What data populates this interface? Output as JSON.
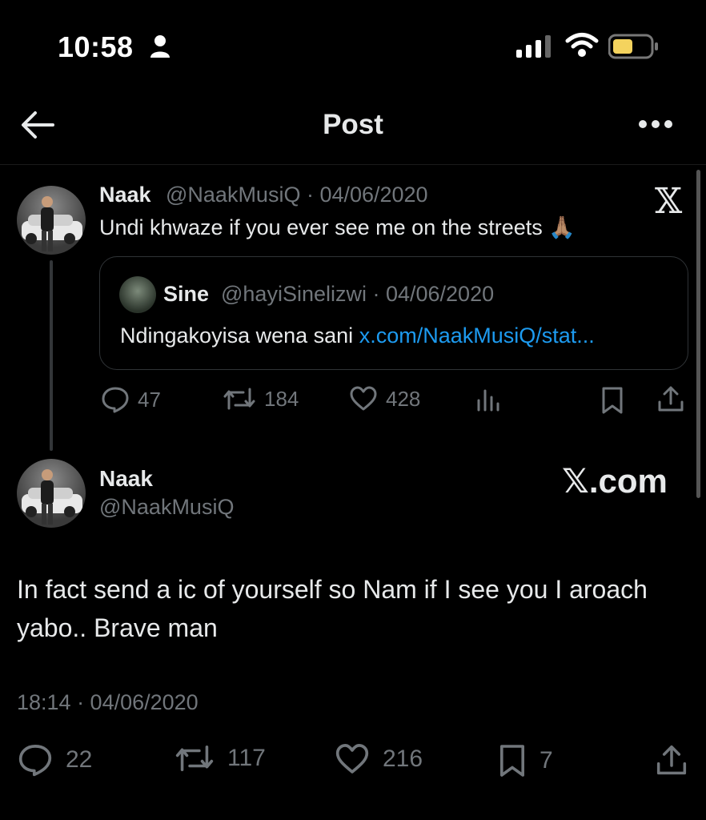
{
  "status_bar": {
    "time": "10:58",
    "icons": [
      "person-icon",
      "cellular-signal-icon",
      "wifi-icon",
      "battery-icon"
    ],
    "battery_color": "#f4d35e"
  },
  "header": {
    "title": "Post",
    "back_icon": "arrow-left-icon",
    "more_icon": "more-dots-icon"
  },
  "quoted_parent": {
    "name": "Naak",
    "handle_date": "@NaakMusiQ · 04/06/2020",
    "text": "Undi khwaze if you ever see me on the streets 🙏🏽",
    "brand": "𝕏",
    "quote": {
      "name": "Sine",
      "handle_date": "@hayiSinelizwi · 04/06/2020",
      "text": "Ndingakoyisa wena sani ",
      "link": "x.com/NaakMusiQ/stat..."
    },
    "actions": {
      "replies": "47",
      "reposts": "184",
      "likes": "428"
    }
  },
  "main_post": {
    "name": "Naak",
    "handle": "@NaakMusiQ",
    "brand": "𝕏.com",
    "text": "In fact send a ic of yourself so Nam if I see you I aroach yabo.. Brave man",
    "timestamp": "18:14 · 04/06/2020",
    "actions": {
      "replies": "22",
      "reposts": "117",
      "likes": "216",
      "bookmarks": "7"
    }
  },
  "colors": {
    "background": "#000000",
    "text": "#e7e9ea",
    "muted": "#71767b",
    "link": "#1d9bf0"
  }
}
